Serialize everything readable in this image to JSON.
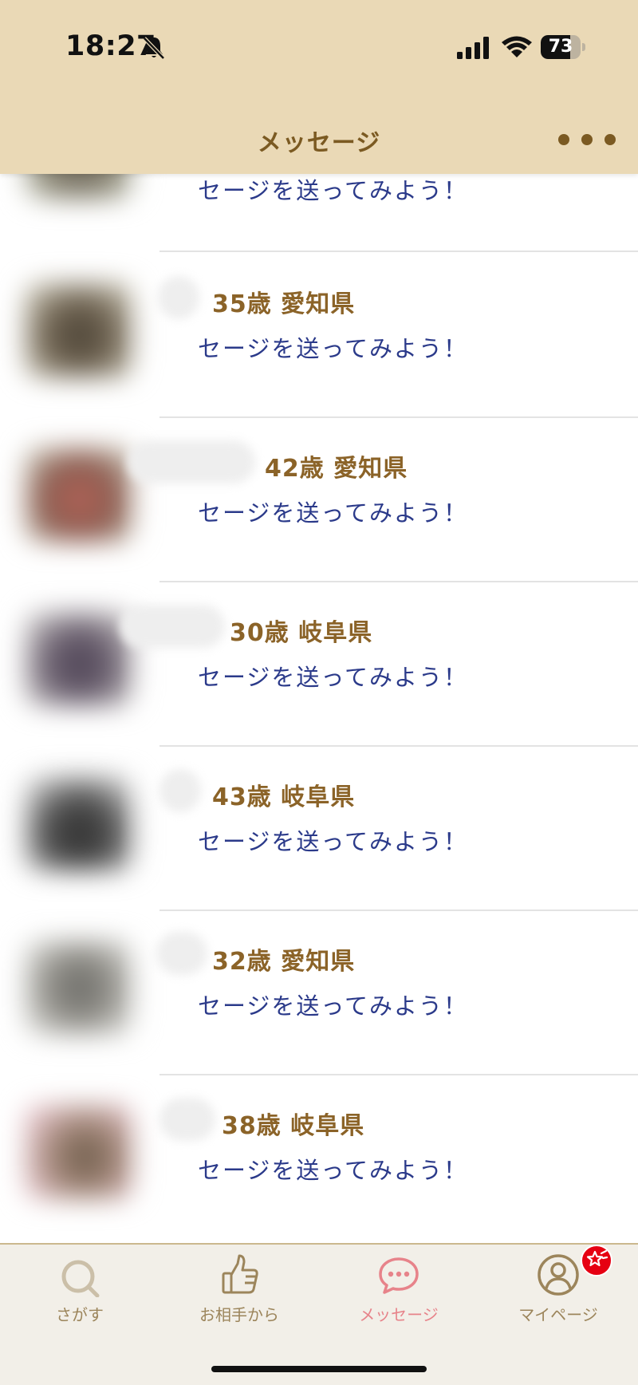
{
  "status_bar": {
    "time": "18:27",
    "battery": "73",
    "battery_level": 0.73
  },
  "header": {
    "title": "メッセージ"
  },
  "messages": [
    {
      "info": "",
      "preview": "セージを送ってみよう！"
    },
    {
      "info": "35歳 愛知県",
      "preview": "セージを送ってみよう！"
    },
    {
      "info": "42歳 愛知県",
      "preview": "セージを送ってみよう！"
    },
    {
      "info": "30歳 岐阜県",
      "preview": "セージを送ってみよう！"
    },
    {
      "info": "43歳 岐阜県",
      "preview": "セージを送ってみよう！"
    },
    {
      "info": "32歳 愛知県",
      "preview": "セージを送ってみよう！"
    },
    {
      "info": "38歳 岐阜県",
      "preview": "セージを送ってみよう！"
    }
  ],
  "tabbar": {
    "search": "さがす",
    "from_partner": "お相手から",
    "messages": "メッセージ",
    "mypage": "マイページ"
  },
  "colors": {
    "header_bg": "#ead9b6",
    "title": "#7b5a22",
    "info_text": "#8b6328",
    "message_text": "#2b3a8a",
    "active_tab": "#e7838a",
    "badge": "#e60012"
  },
  "icons": {
    "search": "search-icon",
    "thumbs_up": "thumbs-up-icon",
    "chat": "chat-bubble-icon",
    "person": "person-icon",
    "more": "more-dots-icon"
  }
}
